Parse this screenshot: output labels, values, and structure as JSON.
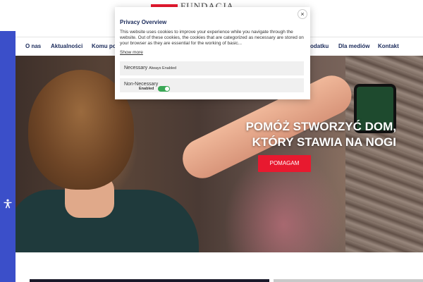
{
  "header": {
    "logo_text": "FUNDACJA"
  },
  "nav": {
    "items": [
      {
        "label": "O nas"
      },
      {
        "label": "Aktualności"
      },
      {
        "label": "Komu po"
      },
      {
        "label": "odatku"
      },
      {
        "label": "Dla mediów"
      },
      {
        "label": "Kontakt"
      }
    ]
  },
  "hero": {
    "line1": "POMÓŻ STWORZYĆ DOM,",
    "line2": "KTÓRY STAWIA NA NOGI",
    "button": "POMAGAM"
  },
  "cookie": {
    "close": "×",
    "title": "Privacy Overview",
    "description": "This website uses cookies to improve your experience while you navigate through the website. Out of these cookies, the cookies that are categorized as necessary are stored on your browser as they are essential for the working of basic...",
    "show_more": "Show more",
    "necessary_label": "Necessary",
    "necessary_status": "Always Enabled",
    "non_necessary_label": "Non-Necessary",
    "toggle_state": "Enabled"
  },
  "accessibility": {
    "icon": "accessibility-icon"
  },
  "colors": {
    "accent": "#e8192f",
    "nav_text": "#1a2a5a",
    "strip": "#3b4fc9",
    "toggle": "#3aa856"
  }
}
